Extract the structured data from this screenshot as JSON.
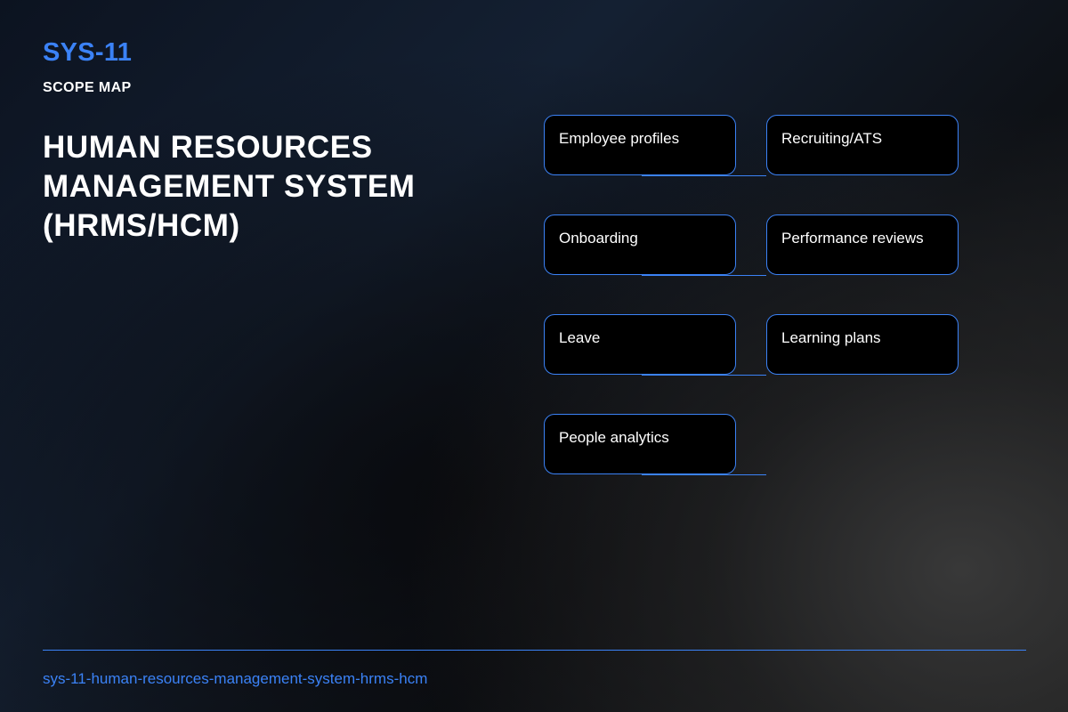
{
  "header": {
    "sys_id": "SYS-11",
    "subtitle": "SCOPE MAP",
    "title": "HUMAN RESOURCES MANAGEMENT SYSTEM (HRMS/HCM)"
  },
  "scope_items": [
    "Employee profiles",
    "Recruiting/ATS",
    "Onboarding",
    "Performance reviews",
    "Leave",
    "Learning plans",
    "People analytics"
  ],
  "footer": {
    "slug": "sys-11-human-resources-management-system-hrms-hcm"
  },
  "colors": {
    "accent": "#3b82f6",
    "node_fill": "#000000",
    "text": "#ffffff"
  }
}
